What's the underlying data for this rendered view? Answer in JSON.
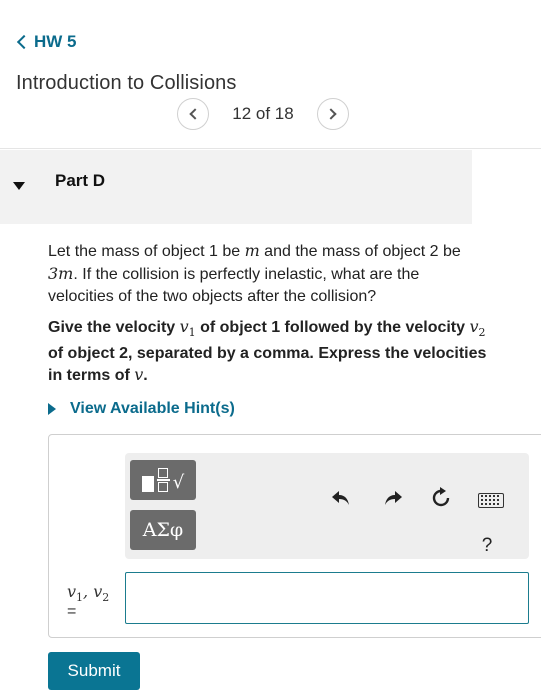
{
  "nav": {
    "back_label": "HW 5"
  },
  "header": {
    "title": "Introduction to Collisions"
  },
  "pager": {
    "current": 12,
    "total": 18,
    "label": "12 of 18"
  },
  "part": {
    "label": "Part D"
  },
  "question": {
    "t1": "Let the mass of object 1 be ",
    "m1": "m",
    "t2": " and the mass of object 2 be ",
    "m2": "3m",
    "t3": ". If the collision is perfectly inelastic, what are the velocities of the two objects after the collision?"
  },
  "instructions": {
    "t1": "Give the velocity ",
    "v1": "v",
    "v1_sub": "1",
    "t2": " of object 1 followed by the velocity ",
    "v2": "v",
    "v2_sub": "2",
    "t3": " of object 2, separated by a comma. Express the velocities in terms of ",
    "v": "v",
    "t4": "."
  },
  "hint": {
    "label": "View Available Hint(s)"
  },
  "toolbar": {
    "symbols_label": "ΑΣφ",
    "help_label": "?"
  },
  "answer": {
    "label_v1": "v",
    "label_v1_sub": "1",
    "label_sep": ", ",
    "label_v2": "v",
    "label_v2_sub": "2",
    "label_eq": "=",
    "value": ""
  },
  "submit": {
    "label": "Submit"
  },
  "colors": {
    "accent": "#0a7593",
    "link": "#0b6b8c",
    "input_border": "#1b7c8e"
  }
}
